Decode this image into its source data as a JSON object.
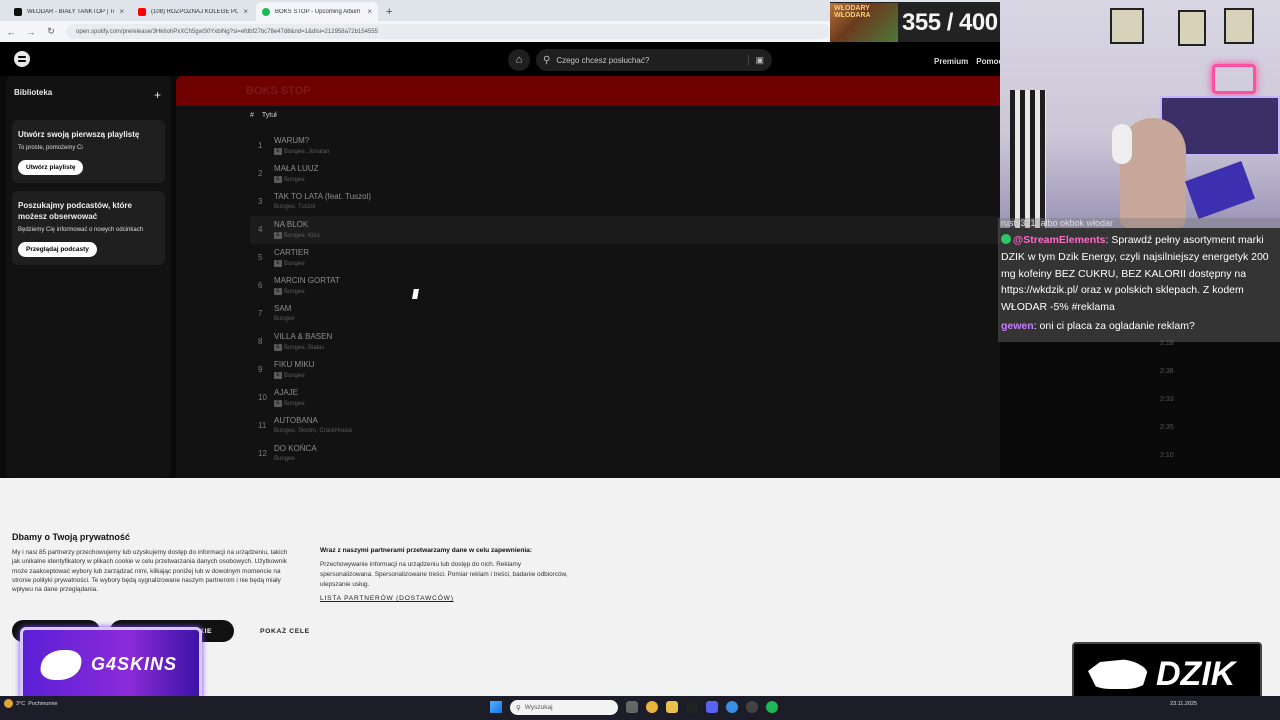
{
  "browser": {
    "tabs": [
      {
        "title": "WŁODAR - BIAŁY TANKTOP | Ti",
        "color": "#111111"
      },
      {
        "title": "(108) ROZPOZNAJ KOLEGE PO",
        "color": "#ff0000"
      },
      {
        "title": "BOKS STOP - Upcoming Album",
        "color": "#1db954"
      }
    ],
    "new_tab": "+",
    "close": "×",
    "url": "open.spotify.com/prerelease/3Hk6ohPxXCh5gwS0YxbiNg?si=efdbf27bc78e47d8&nd=1&dlsi=212958a72b154555"
  },
  "counter": {
    "art_label": "WŁODARY WŁODARA",
    "text": "355 / 400"
  },
  "spotify": {
    "search_placeholder": "Czego chcesz posłuchać?",
    "top_links": [
      "Premium",
      "Pomoc"
    ],
    "library": {
      "title": "Biblioteka",
      "cards": [
        {
          "title": "Utwórz swoją pierwszą playlistę",
          "text": "To proste, pomożemy Ci",
          "button": "Utwórz playlistę"
        },
        {
          "title": "Poszukajmy podcastów, które możesz obserwować",
          "text": "Będziemy Cię informować o nowych odcinkach",
          "button": "Przeglądaj podcasty"
        }
      ]
    },
    "album_title": "BOKS STOP",
    "columns": {
      "num": "#",
      "title": "Tytuł"
    },
    "tracks": [
      {
        "num": "1",
        "title": "WARUM?",
        "artists": "Bungee, Jonatan",
        "explicit": true
      },
      {
        "num": "2",
        "title": "MAŁA LUUZ",
        "artists": "Bungee",
        "explicit": true
      },
      {
        "num": "3",
        "title": "TAK TO LATA (feat. Tuszol)",
        "artists": "Bungee, Tuszol",
        "explicit": false
      },
      {
        "num": "4",
        "title": "NA BLOK",
        "artists": "Bungee, Kizo",
        "explicit": true
      },
      {
        "num": "5",
        "title": "CARTIER",
        "artists": "Bungee",
        "explicit": true
      },
      {
        "num": "6",
        "title": "MARCIN GORTAT",
        "artists": "Bungee",
        "explicit": true
      },
      {
        "num": "7",
        "title": "SAM",
        "artists": "Bungee",
        "explicit": false
      },
      {
        "num": "8",
        "title": "VILLA & BASEN",
        "artists": "Bungee, Białas",
        "explicit": true
      },
      {
        "num": "9",
        "title": "FIKU MIKU",
        "artists": "Bungee",
        "explicit": true
      },
      {
        "num": "10",
        "title": "AJAJE",
        "artists": "Bungee",
        "explicit": true
      },
      {
        "num": "11",
        "title": "AUTOBANA",
        "artists": "Bungee, Skolim, CrackHouse",
        "explicit": false
      },
      {
        "num": "12",
        "title": "DO KOŃCA",
        "artists": "Bungee",
        "explicit": false
      }
    ],
    "durations": [
      "2:18",
      "2:38",
      "2:33",
      "2:35",
      "2:10"
    ]
  },
  "chat": {
    "cut_line": "rusty321: albo okbok włodar",
    "messages": [
      {
        "user": "@StreamElements",
        "text": ": Sprawdź pełny asortyment marki DZIK w tym Dzik Energy, czyli najsilniejszy energetyk 200 mg kofeiny BEZ CUKRU, BEZ KALORII dostępny na https://wkdzik.pl/ oraz w polskich sklepach. Z kodem WŁODAR -5% #reklama"
      },
      {
        "user": "gewen",
        "text": ": oni ci placa za ogladanie reklam?"
      }
    ]
  },
  "cookie": {
    "title": "Dbamy o Twoją prywatność",
    "body": "My i nasi 85 partnerzy przechowujemy lub uzyskujemy dostęp do informacji na urządzeniu, takich jak unikalne identyfikatory w plikach cookie w celu przetwarzania danych osobowych. Użytkownik może zaakceptować wybory lub zarządzać nimi, kilkając poniżej lub w dowolnym momencie na stronie polityki prywatności. Te wybory będą sygnalizowane naszym partnerom i nie będą miały wpływu na dane przeglądania.",
    "purposes_title": "Wraz z naszymi partnerami przetwarzamy dane w celu zapewnienia:",
    "purposes": "Przechowywanie informacji na urządzeniu lub dostęp do nich. Reklamy spersonalizowana. Spersonalizowane treści. Pomiar reklam i treści, badanie odbiorców, ulepszanie usług.",
    "partners_link": "LISTA PARTNERÓW (DOSTAWCÓW)",
    "button2": "KIE",
    "show_purposes": "POKAŻ CELE"
  },
  "ads": {
    "g4skins": "G4SKINS",
    "dzik": "DZIK"
  },
  "taskbar": {
    "weather_temp": "3°C",
    "weather_desc": "Pochmurnie",
    "search_placeholder": "Wyszukaj",
    "date": "23.11.2025"
  }
}
